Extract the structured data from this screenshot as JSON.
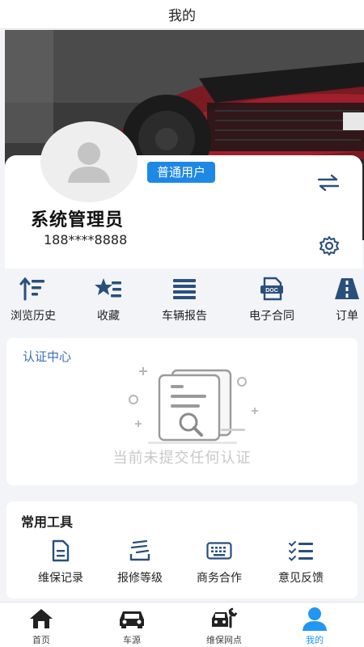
{
  "header": {
    "title": "我的"
  },
  "profile": {
    "role_badge": "普通用户",
    "name": "系统管理员",
    "phone": "188****8888"
  },
  "quick_menu": [
    {
      "label": "浏览历史",
      "icon": "sort-history-icon"
    },
    {
      "label": "收藏",
      "icon": "star-list-icon"
    },
    {
      "label": "车辆报告",
      "icon": "report-lines-icon"
    },
    {
      "label": "电子合同",
      "icon": "doc-contract-icon"
    },
    {
      "label": "订单",
      "icon": "road-order-icon"
    }
  ],
  "certification": {
    "title": "认证中心",
    "empty_text": "当前未提交任何认证"
  },
  "tools": {
    "title": "常用工具",
    "items": [
      {
        "label": "维保记录",
        "icon": "document-icon"
      },
      {
        "label": "报修等级",
        "icon": "stack-icon"
      },
      {
        "label": "商务合作",
        "icon": "keyboard-icon"
      },
      {
        "label": "意见反馈",
        "icon": "checklist-icon"
      }
    ]
  },
  "tabbar": {
    "items": [
      {
        "label": "首页",
        "icon": "home-icon"
      },
      {
        "label": "车源",
        "icon": "car-icon"
      },
      {
        "label": "维保网点",
        "icon": "repair-car-icon"
      },
      {
        "label": "我的",
        "icon": "user-icon"
      }
    ],
    "active_index": 3
  },
  "colors": {
    "accent": "#1e88e5",
    "icon_dark": "#2a4f7c",
    "active_tab": "#2196f3"
  }
}
